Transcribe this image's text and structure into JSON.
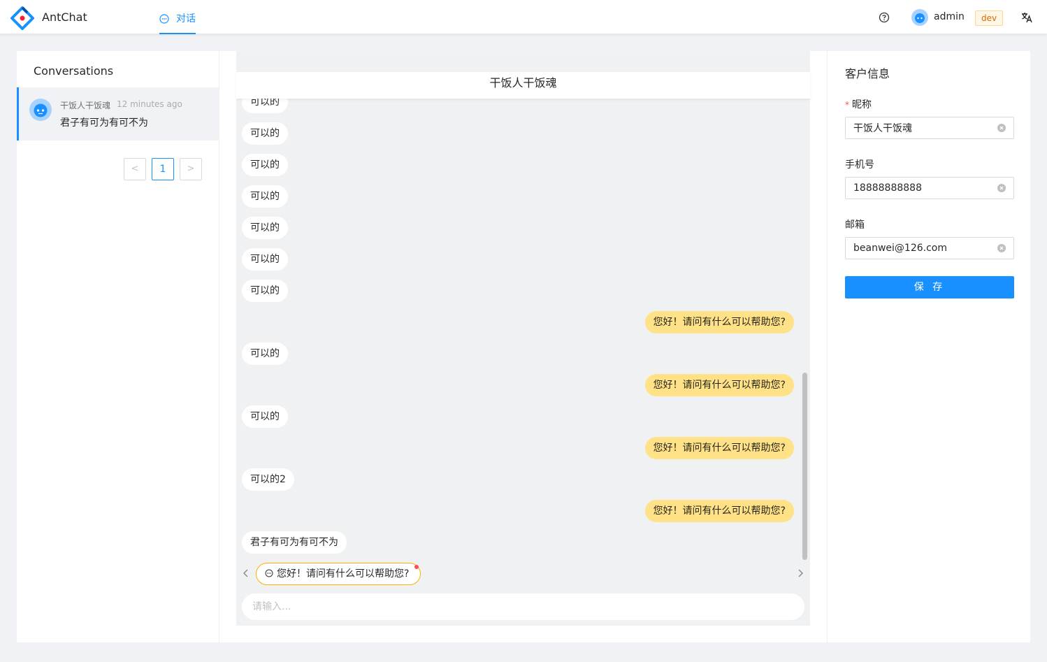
{
  "header": {
    "brand": "AntChat",
    "nav_tab": "对话",
    "user_name": "admin",
    "env_tag": "dev"
  },
  "left_panel": {
    "title": "Conversations",
    "conversations": [
      {
        "name": "干饭人干饭魂",
        "time": "12 minutes ago",
        "last_message": "君子有可为有可不为"
      }
    ],
    "pagination": {
      "current_page": "1",
      "prev": "<",
      "next": ">"
    }
  },
  "chat": {
    "title": "干饭人干饭魂",
    "messages": [
      {
        "side": "left",
        "text": "可以的"
      },
      {
        "side": "left",
        "text": "可以的"
      },
      {
        "side": "left",
        "text": "可以的"
      },
      {
        "side": "left",
        "text": "可以的"
      },
      {
        "side": "left",
        "text": "可以的"
      },
      {
        "side": "left",
        "text": "可以的"
      },
      {
        "side": "left",
        "text": "可以的"
      },
      {
        "side": "right",
        "text": "您好！请问有什么可以帮助您?"
      },
      {
        "side": "left",
        "text": "可以的"
      },
      {
        "side": "right",
        "text": "您好！请问有什么可以帮助您?"
      },
      {
        "side": "left",
        "text": "可以的"
      },
      {
        "side": "right",
        "text": "您好！请问有什么可以帮助您?"
      },
      {
        "side": "left",
        "text": "可以的2"
      },
      {
        "side": "right",
        "text": "您好！请问有什么可以帮助您?"
      },
      {
        "side": "left",
        "text": "君子有可为有可不为"
      }
    ],
    "quick_reply": "您好！请问有什么可以帮助您?",
    "input_placeholder": "请输入..."
  },
  "right_panel": {
    "title": "客户信息",
    "nickname_label": "昵称",
    "nickname_required_mark": "*",
    "nickname_value": "干饭人干饭魂",
    "phone_label": "手机号",
    "phone_value": "18888888888",
    "email_label": "邮箱",
    "email_value": "beanwei@126.com",
    "save_label": "保 存"
  },
  "colors": {
    "primary": "#1890ff",
    "agent_bubble": "#ffe288",
    "customer_bubble": "#ffffff",
    "dev_tag": "#d46b08"
  },
  "icons": {
    "logo": "antchat-logo-icon",
    "nav": "message-icon",
    "help": "question-circle-icon",
    "avatar": "robot-avatar-icon",
    "translate": "translate-icon",
    "clear": "close-circle-icon"
  }
}
